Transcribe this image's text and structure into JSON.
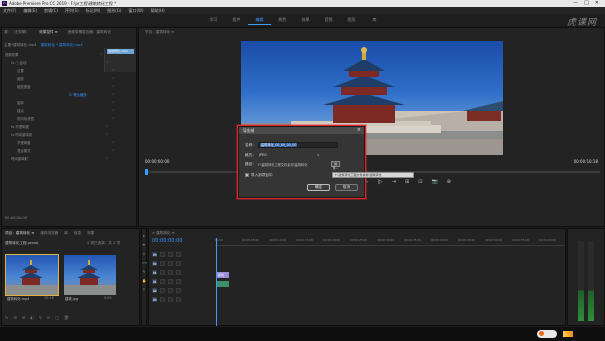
{
  "app": {
    "title": "Adobe Premiere Pro CC 2019 - F:\\pr工程\\建筑转化工程 *",
    "logo_text": "Pr",
    "window_controls": [
      "—",
      "□",
      "✕"
    ]
  },
  "menu": [
    "文件(F)",
    "编辑(E)",
    "剪辑(C)",
    "序列(S)",
    "标记(M)",
    "图形(G)",
    "窗口(W)",
    "帮助(H)"
  ],
  "workspaces": [
    {
      "label": "学习",
      "active": false
    },
    {
      "label": "组件",
      "active": false
    },
    {
      "label": "编辑",
      "active": true
    },
    {
      "label": "颜色",
      "active": false
    },
    {
      "label": "效果",
      "active": false
    },
    {
      "label": "音频",
      "active": false
    },
    {
      "label": "图形",
      "active": false
    },
    {
      "label": "库",
      "active": false
    }
  ],
  "watermark": "虎课网",
  "effect_controls": {
    "tabs": [
      "源：（无剪辑）",
      "效果控件 ≡",
      "音频剪辑混合器：建筑转化"
    ],
    "clip_path": "主要*建筑转化.mp4",
    "clip_sequence": "建筑转化 * 建筑转化.mp4",
    "mini_clip": "建筑转化.mp4",
    "rows": [
      {
        "label": "视频效果",
        "value": "",
        "indent": 0
      },
      {
        "label": "fx ▢ 运动",
        "value": "",
        "indent": 1
      },
      {
        "label": "位置",
        "value": "",
        "indent": 2
      },
      {
        "label": "缩放",
        "value": "",
        "indent": 2
      },
      {
        "label": "缩放宽度",
        "value": "",
        "indent": 2
      },
      {
        "label": "",
        "value": "☑ 等比缩放",
        "indent": 2
      },
      {
        "label": "旋转",
        "value": "",
        "indent": 2
      },
      {
        "label": "锚点",
        "value": "",
        "indent": 2
      },
      {
        "label": "防闪烁滤镜",
        "value": "",
        "indent": 2
      },
      {
        "label": "fx 不透明度",
        "value": "",
        "indent": 1
      },
      {
        "label": "fx 时间重映射",
        "value": "",
        "indent": 1
      },
      {
        "label": "不透明度",
        "value": "",
        "indent": 2
      },
      {
        "label": "混合模式",
        "value": "",
        "indent": 2
      },
      {
        "label": "时间重映射",
        "value": "",
        "indent": 1
      }
    ],
    "timecode": "00:00:00:00"
  },
  "program": {
    "tab": "节目：建筑转化 ≡",
    "timecode": "00:00:00:00",
    "fit": "",
    "duration": "00:00:10:18",
    "transport": [
      "⇤",
      "◁|",
      "◁",
      "▶",
      "▷",
      "|▷",
      "⇥",
      "⊞",
      "⊡",
      "📷",
      "⊕"
    ]
  },
  "project": {
    "tabs": [
      "项目：建筑转化 ≡",
      "媒体浏览器",
      "库",
      "信息",
      "效果"
    ],
    "name": "建筑转化工程.prproj",
    "count": "2 项已选择，共 2 项",
    "items": [
      {
        "label": "建筑转化.mp4",
        "duration": "10:18",
        "selected": true
      },
      {
        "label": "建筑.jpg",
        "duration": "5:00",
        "selected": false
      }
    ],
    "bottom_icons": [
      "✎",
      "☰",
      "⊞",
      "◐",
      "⚲",
      "⊖",
      "▢",
      "🗑"
    ]
  },
  "tools": [
    "▸",
    "⇹",
    "◇",
    "⟺",
    "✎",
    "✋",
    "T"
  ],
  "timeline": {
    "tab": "× 建筑转化 ≡",
    "timecode": "00:00:00:00",
    "ruler": [
      "00:00",
      "00:00:05:00",
      "00:00:10:00",
      "00:00:15:00",
      "00:00:20:00",
      "00:00:25:00",
      "00:00:30:00",
      "00:00:35:00",
      "00:00:40:00",
      "00:00:45:00",
      "00:00:50:00",
      "00:00:55:00",
      "00:01:00:00"
    ],
    "tracks": [
      "V3",
      "V2",
      "V1",
      "A1",
      "A2",
      "A3"
    ],
    "clip_label": "建筑"
  },
  "dialog": {
    "title": "导出帧",
    "name_label": "名称：",
    "name_value": "建筑转化_00_00_00_00",
    "format_label": "格式：",
    "format_value": "JPEG",
    "format_arrow": "∨",
    "path_label": "路径：",
    "path_value": "F:\\建筑转化工程文件素材\\建筑转化",
    "browse_label": "浏览...",
    "import_label": "导入到项目中",
    "import_checked": true,
    "ok_label": "确定",
    "cancel_label": "取消"
  },
  "tooltip": "F:\\建筑转化工程文件素材\\建筑转化",
  "taskbar": {
    "clock_time": "",
    "clock_date": ""
  },
  "colors": {
    "accent": "#3b9bff",
    "dialog_highlight": "#e0242a",
    "panel_bg": "#232323"
  }
}
